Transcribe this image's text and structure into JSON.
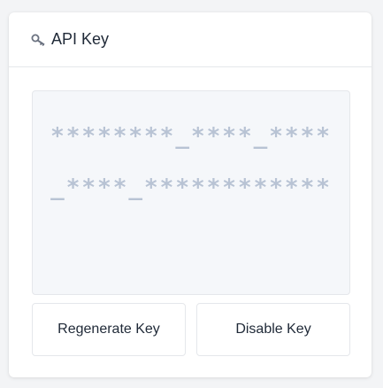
{
  "card": {
    "icon": "key-icon",
    "title": "API Key"
  },
  "api_key": {
    "masked_value": "********_****_****_****_************"
  },
  "actions": {
    "regenerate_label": "Regenerate Key",
    "disable_label": "Disable Key"
  },
  "colors": {
    "masked_text": "#b8c3d4",
    "panel_background": "#f5f7fa",
    "border": "#e5e7eb"
  }
}
